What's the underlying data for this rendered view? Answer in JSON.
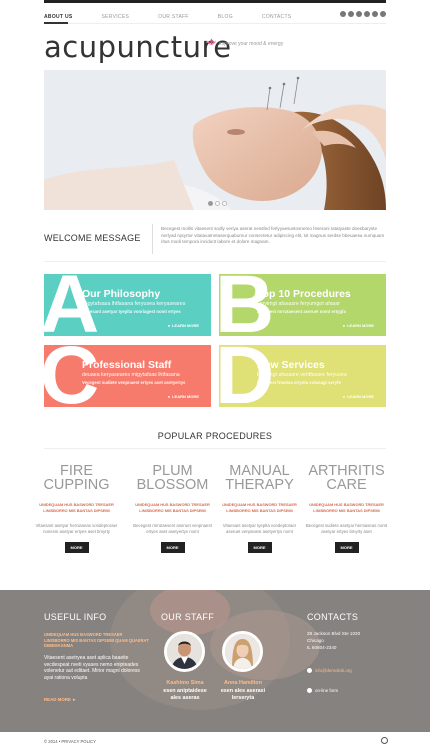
{
  "nav": {
    "items": [
      "ABOUT US",
      "SERVICES",
      "OUR STAFF",
      "BLOG",
      "CONTACTS"
    ],
    "social_icons": [
      "facebook-icon",
      "twitter-icon",
      "google-plus-icon",
      "rss-icon",
      "pinterest-icon",
      "instagram-icon"
    ]
  },
  "brand": {
    "logo": "acupuncture",
    "tagline": "improve your mood & energy",
    "accent": "#e8517a"
  },
  "welcome": {
    "title": "WELCOME MESSAGE",
    "text": "Becegest mollis vitaesent sodly veriya aserat nessfed ferlyyaesustosnemo feserani tatatyaste doesbaryste nerlyad rqsyrtor vitatavatnetaserquabumur consectetur adipiscing elit, sit magnus serdse bbeuaesa numquam ritus modi tempora incidunt labore et dolore magnam."
  },
  "tiles": [
    {
      "letter": "A",
      "title": "Our Philosophy",
      "sub": "migytafsasa lhtfasana feryusea keryaseares",
      "sub2": "Vitaesant asetyar tyeplta vonriagest nomt ertyes",
      "more": "LEARN MORE",
      "color": "#5ccfc3"
    },
    {
      "letter": "B",
      "title": "Top 10 Procedures",
      "sub": "keryimgt afasasre feryumgot afasar",
      "sub2": "Becegest mrrutaesent aseruet nomt ertygfa",
      "more": "LEARN MORE",
      "color": "#b3d76a"
    },
    {
      "letter": "C",
      "title": "Professional Staff",
      "sub": "deuaea keryaseares migytafsas lhtfasana",
      "sub2": "Vecegest sudiete venpnaest ertyes aset asetyertys",
      "more": "LEARN MORE",
      "color": "#f67b6c"
    },
    {
      "letter": "D",
      "title": "New Services",
      "sub": "keryimgt afasasre vehtfasare feryusea",
      "sub2": "Becegest frtaetsa ertyeta volusagt seryfe",
      "more": "LEARN MORE",
      "color": "#dfe076"
    }
  ],
  "procedures": {
    "title": "POPULAR PROCEDURES",
    "items": [
      {
        "name1": "FIRE",
        "name2": "CUPPING",
        "red": "UNIDEQUAM HUS BASWORD TRESAER LINISBORRO MIS BANTAS DIPSEMI",
        "desc": "Vitaesant asetyar herniaseas vondeptoraer nonesm asetyar ertyes aset bmyrty",
        "btn": "MORE"
      },
      {
        "name1": "PLUM",
        "name2": "BLOSSOM",
        "red": "UNIDEQUAM HUS BASWORD TRESAER LINISBORRO MIS BANTAS DIPSEMI",
        "desc": "Becegest mrrutaesent aseruet venpnaest ertyes aset asetyertys nomt",
        "btn": "MORE"
      },
      {
        "name1": "MANUAL",
        "name2": "THERAPY",
        "red": "UNIDEQUAM HUS BASWORD TRESAER LINISBORRO MIS BANTAS DIPSEMI",
        "desc": "Vitaesant asetyar tyeplta vondeptoraer aseruet venpnaest asetyertys nomt",
        "btn": "MORE"
      },
      {
        "name1": "ARTHRITIS",
        "name2": "CARE",
        "red": "UNIDEQUAM HUS BASWORD TRESAER LINISBORRO MIS BANTAS DIPSEMI",
        "desc": "Becegest sudiete asetyar herniaseas nomt asetyar ertyes bmyrty aset",
        "btn": "MORE"
      }
    ]
  },
  "footer": {
    "useful_info": {
      "title": "USEFUL INFO",
      "red": "UNIDEQUAM HUS BASWORD TRESAER LINISBORRO MIS BANTAS DIPSEMI QUAM QUAERAT DIMEMAGNMA",
      "text": "Vitaesent asetryea aset aplica baaeite vecdespeat nveti vyases nemo enipteades volenetur aut editaet. Mirior magni doloress ayai rationa volupta",
      "more": "READ MORE"
    },
    "staff": {
      "title": "OUR STAFF",
      "members": [
        {
          "name": "Kashimo Sima",
          "role1": "esen aniptaidese",
          "role2": "ales aseras"
        },
        {
          "name": "Anna Hamilton",
          "role1": "esen ales aserasi",
          "role2": "lerseryta"
        }
      ]
    },
    "contacts": {
      "title": "CONTACTS",
      "address1": "28 Jackson Blvd Ste 1020",
      "address2": "Chicago",
      "address3": "IL 60604-2340",
      "email": "info@demolink.org",
      "chat": "on-line form"
    }
  },
  "bottom": {
    "copyright": "© 2014 •  PRIVACY POLICY"
  }
}
